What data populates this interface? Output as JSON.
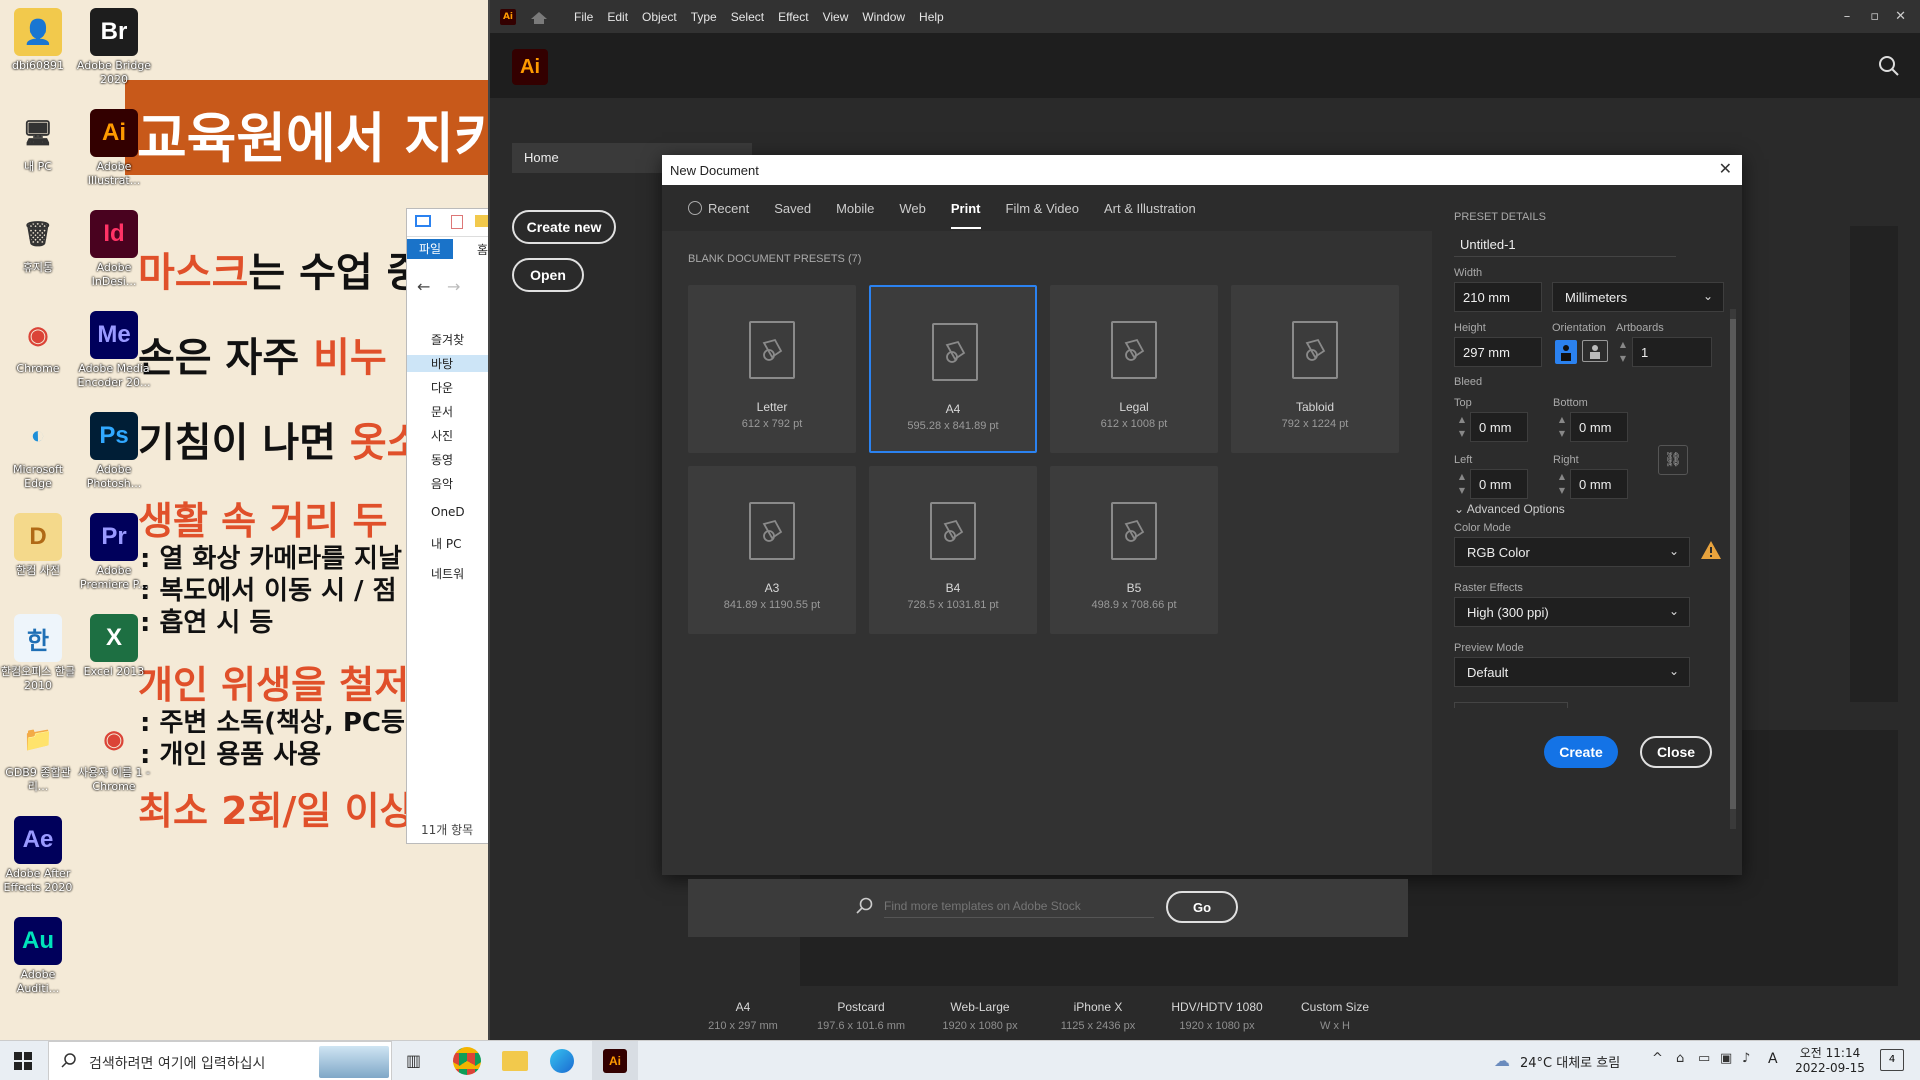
{
  "desktop": {
    "slide": {
      "banner": "교육원에서 지키",
      "line1_a": "마스크",
      "line1_b": "는 수업 중",
      "line2_a": "손은 자주 ",
      "line2_b": "비누 !",
      "line3_a": "기침이 나면 ",
      "line3_b": "옷소",
      "line4": "생활 속 거리 두",
      "line5": ": 열 화상 카메라를 지날",
      "line6": ": 복도에서 이동 시 / 점",
      "line7": ": 흡연 시 등",
      "line8": "개인 위생을 철저",
      "line9": ": 주변 소독(책상, PC등)",
      "line10": ": 개인 용품 사용",
      "line11": "최소 2회/일 이상"
    },
    "icons": [
      {
        "label": "dbi60891",
        "glyph": "👤",
        "bg": "#f2c94c",
        "fg": "#333"
      },
      {
        "label": "내 PC",
        "glyph": "🖥",
        "bg": "transparent",
        "fg": "#333"
      },
      {
        "label": "휴지통",
        "glyph": "🗑",
        "bg": "transparent",
        "fg": "#333"
      },
      {
        "label": "Chrome",
        "glyph": "◉",
        "bg": "transparent",
        "fg": "#db4437"
      },
      {
        "label": "Microsoft Edge",
        "glyph": "◐",
        "bg": "transparent",
        "fg": "#1e8fd8"
      },
      {
        "label": "한컴 사전",
        "glyph": "D",
        "bg": "#f4d98b",
        "fg": "#b06a16"
      },
      {
        "label": "한컴오피스 한글 2010",
        "glyph": "한",
        "bg": "#eef5fb",
        "fg": "#1f6fb5"
      },
      {
        "label": "GDB9 종합관리...",
        "glyph": "📁",
        "bg": "transparent",
        "fg": "#333"
      },
      {
        "label": "Adobe After Effects 2020",
        "glyph": "Ae",
        "bg": "#00005b",
        "fg": "#9999ff"
      },
      {
        "label": "Adobe Auditi...",
        "glyph": "Au",
        "bg": "#00005b",
        "fg": "#00e4bb"
      },
      {
        "label": "Adobe Bridge 2020",
        "glyph": "Br",
        "bg": "#1d1d1d",
        "fg": "#ffffff"
      },
      {
        "label": "Adobe Illustrat...",
        "glyph": "Ai",
        "bg": "#330000",
        "fg": "#ff9a00"
      },
      {
        "label": "Adobe InDesi...",
        "glyph": "Id",
        "bg": "#49021f",
        "fg": "#ff3366"
      },
      {
        "label": "Adobe Media Encoder 20...",
        "glyph": "Me",
        "bg": "#00005b",
        "fg": "#9999ff"
      },
      {
        "label": "Adobe Photosh...",
        "glyph": "Ps",
        "bg": "#001e36",
        "fg": "#31a8ff"
      },
      {
        "label": "Adobe Premiere P...",
        "glyph": "Pr",
        "bg": "#00005b",
        "fg": "#9999ff"
      },
      {
        "label": "Excel 2013",
        "glyph": "X",
        "bg": "#1d6f42",
        "fg": "#ffffff"
      },
      {
        "label": "사용자 이름 1 - Chrome",
        "glyph": "◉",
        "bg": "transparent",
        "fg": "#db4437"
      }
    ]
  },
  "explorer": {
    "tab_file": "파일",
    "tab_home": "홈",
    "nav": [
      "즐겨찾",
      "바탕",
      "다운",
      "문서",
      "사진",
      "동영",
      "음악",
      "OneD",
      "내 PC",
      "네트워"
    ],
    "status": "11개 항목"
  },
  "illustrator": {
    "app_icon": "Ai",
    "menu": [
      "File",
      "Edit",
      "Object",
      "Type",
      "Select",
      "Effect",
      "View",
      "Window",
      "Help"
    ],
    "logo": "Ai",
    "home_label": "Home",
    "create_new": "Create new",
    "open": "Open",
    "home_cards": [
      {
        "name": "A4",
        "size": "210 x 297 mm"
      },
      {
        "name": "Postcard",
        "size": "197.6 x 101.6 mm"
      },
      {
        "name": "Web-Large",
        "size": "1920 x 1080 px"
      },
      {
        "name": "iPhone X",
        "size": "1125 x 2436 px"
      },
      {
        "name": "HDV/HDTV 1080",
        "size": "1920 x 1080 px"
      },
      {
        "name": "Custom Size",
        "size": "W x H"
      }
    ]
  },
  "dialog": {
    "title": "New Document",
    "tabs": [
      "Recent",
      "Saved",
      "Mobile",
      "Web",
      "Print",
      "Film & Video",
      "Art & Illustration"
    ],
    "active_tab": "Print",
    "presets_heading": "BLANK DOCUMENT PRESETS",
    "presets_count": "(7)",
    "presets": [
      {
        "name": "Letter",
        "size": "612 x 792 pt"
      },
      {
        "name": "A4",
        "size": "595.28 x 841.89 pt"
      },
      {
        "name": "Legal",
        "size": "612 x 1008 pt"
      },
      {
        "name": "Tabloid",
        "size": "792 x 1224 pt"
      },
      {
        "name": "A3",
        "size": "841.89 x 1190.55 pt"
      },
      {
        "name": "B4",
        "size": "728.5 x 1031.81 pt"
      },
      {
        "name": "B5",
        "size": "498.9 x 708.66 pt"
      }
    ],
    "selected_preset": "A4",
    "search_placeholder": "Find more templates on Adobe Stock",
    "go": "Go",
    "details": {
      "heading": "PRESET DETAILS",
      "name": "Untitled-1",
      "width_label": "Width",
      "width": "210 mm",
      "units": "Millimeters",
      "height_label": "Height",
      "height": "297 mm",
      "orientation_label": "Orientation",
      "artboards_label": "Artboards",
      "artboards": "1",
      "bleed_label": "Bleed",
      "top_label": "Top",
      "top": "0 mm",
      "bottom_label": "Bottom",
      "bottom": "0 mm",
      "left_label": "Left",
      "left": "0 mm",
      "right_label": "Right",
      "right": "0 mm",
      "advanced": "Advanced Options",
      "color_mode_label": "Color Mode",
      "color_mode": "RGB Color",
      "raster_label": "Raster Effects",
      "raster": "High (300 ppi)",
      "preview_label": "Preview Mode",
      "preview": "Default"
    },
    "create": "Create",
    "close": "Close"
  },
  "taskbar": {
    "search_placeholder": "검색하려면 여기에 입력하십시",
    "weather": "24°C 대체로 흐림",
    "ime": "A",
    "time": "오전 11:14",
    "date": "2022-09-15",
    "notif_count": "4"
  },
  "colors": {
    "accent": "#2b82f0",
    "ai_orange": "#ff9a00",
    "ai_bg": "#330000",
    "warning": "#e8a33d"
  }
}
